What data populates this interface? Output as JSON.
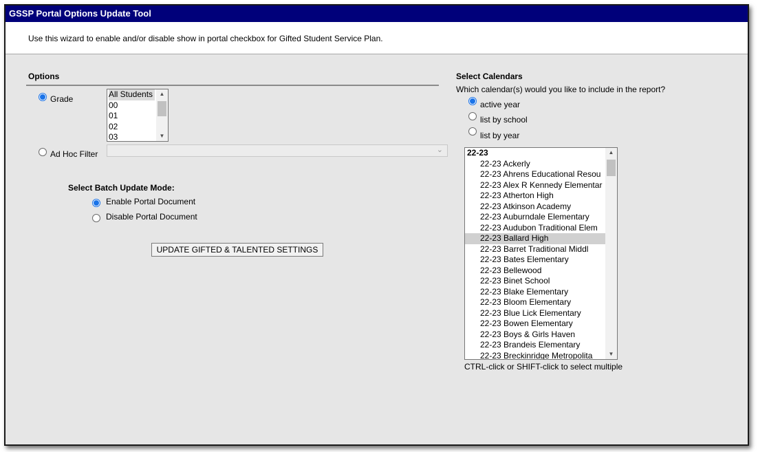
{
  "window": {
    "title": "GSSP Portal Options Update Tool"
  },
  "description": "Use this wizard to enable and/or disable show in portal checkbox for Gifted Student Service Plan.",
  "options": {
    "heading": "Options",
    "grade_label": "Grade",
    "grade_selected": true,
    "grades": [
      "All Students",
      "00",
      "01",
      "02",
      "03"
    ],
    "adhoc_label": "Ad Hoc Filter",
    "adhoc_value": ""
  },
  "batch": {
    "heading": "Select Batch Update Mode:",
    "enable_label": "Enable Portal Document",
    "disable_label": "Disable Portal Document",
    "mode": "enable"
  },
  "update_button_label": "UPDATE GIFTED & TALENTED SETTINGS",
  "calendars": {
    "heading": "Select Calendars",
    "question": "Which calendar(s) would you like to include in the report?",
    "radio_active": "active year",
    "radio_school": "list by school",
    "radio_year": "list by year",
    "selected_mode": "active year",
    "group_label": "22-23",
    "items": [
      "22-23 Ackerly",
      "22-23 Ahrens Educational Resou",
      "22-23 Alex R Kennedy Elementar",
      "22-23 Atherton High",
      "22-23 Atkinson Academy",
      "22-23 Auburndale Elementary",
      "22-23 Audubon Traditional Elem",
      "22-23 Ballard High",
      "22-23 Barret Traditional Middl",
      "22-23 Bates Elementary",
      "22-23 Bellewood",
      "22-23 Binet School",
      "22-23 Blake Elementary",
      "22-23 Bloom Elementary",
      "22-23 Blue Lick Elementary",
      "22-23 Bowen Elementary",
      "22-23 Boys & Girls Haven",
      "22-23 Brandeis Elementary",
      "22-23 Breckinridge Metropolita"
    ],
    "highlighted": "22-23 Ballard High",
    "hint": "CTRL-click or SHIFT-click to select multiple"
  },
  "colors": {
    "titlebar": "#00007a",
    "panel": "#e6e6e6",
    "radio_checked": "#1a73e8",
    "highlight": "#d0d0d0"
  }
}
